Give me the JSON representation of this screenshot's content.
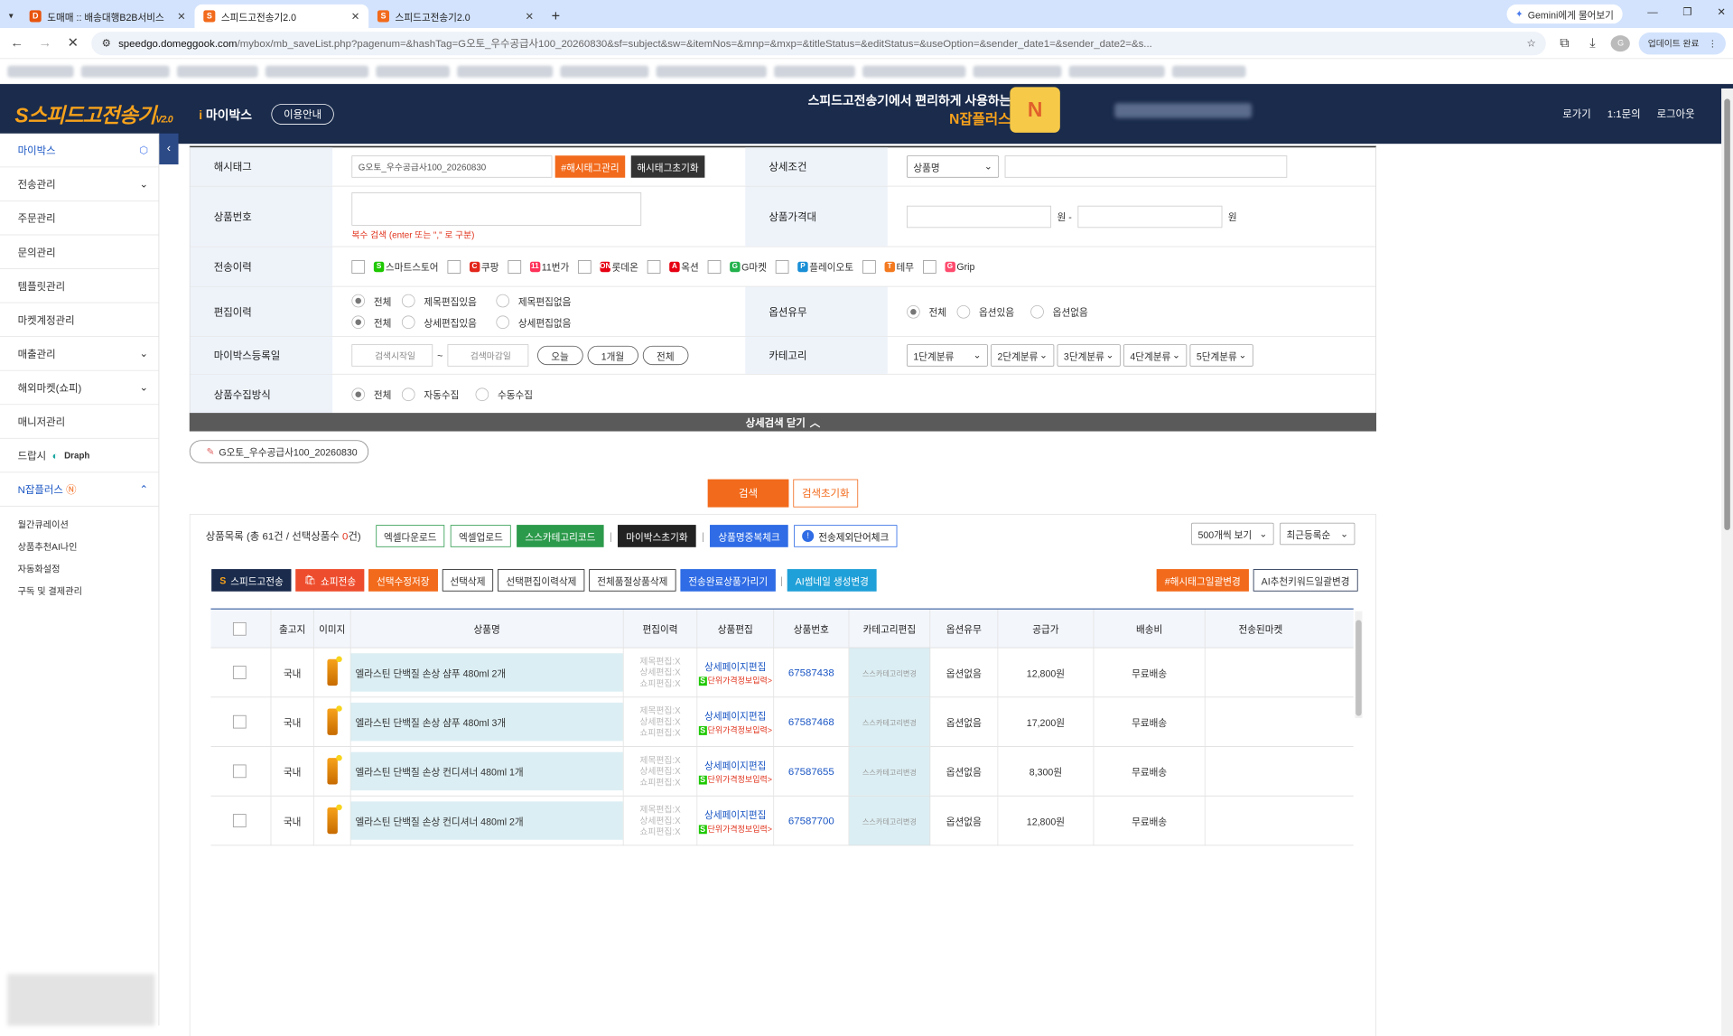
{
  "browser": {
    "tabs": [
      {
        "title": "도매매 :: 배송대행B2B서비스",
        "favicon": "d-icon",
        "color": "#e8540e"
      },
      {
        "title": "스피드고전송기2.0",
        "favicon": "s-icon",
        "color": "#f26a1b"
      },
      {
        "title": "스피드고전송기2.0",
        "favicon": "s-icon",
        "color": "#f26a1b"
      }
    ],
    "gemini_label": "Gemini에게 물어보기",
    "url_host": "speedgo.domeggook.com",
    "url_path": "/mybox/mb_saveList.php?pagenum=&hashTag=G오토_우수공급사100_20260830&sf=subject&sw=&itemNos=&mnp=&mxp=&titleStatus=&editStatus=&useOption=&sender_date1=&sender_date2=&s...",
    "update_label": "업데이트 완료"
  },
  "header": {
    "logo": "스피드고전송기",
    "logo_version": "V2.0",
    "mybox": "마이박스",
    "guide": "이용안내",
    "banner_line1": "스피드고전송기에서 편리하게 사용하는",
    "banner_line2": "N잡플러스",
    "links": [
      "로가기",
      "1:1문의",
      "로그아웃"
    ]
  },
  "sidebar": {
    "items": [
      {
        "label": "마이박스",
        "icon": "box-icon",
        "blue": true
      },
      {
        "label": "전송관리",
        "icon": "chevron-down-icon"
      },
      {
        "label": "주문관리"
      },
      {
        "label": "문의관리"
      },
      {
        "label": "템플릿관리"
      },
      {
        "label": "마켓계정관리"
      },
      {
        "label": "매출관리",
        "icon": "chevron-down-icon"
      },
      {
        "label": "해외마켓(쇼피)",
        "icon": "chevron-down-icon"
      },
      {
        "label": "매니저관리"
      },
      {
        "label": "드랍시",
        "extra": "Draph"
      },
      {
        "label": "N잡플러스",
        "icon": "chevron-up-icon",
        "blue": true
      }
    ],
    "subitems": [
      "월간큐레이션",
      "상품추천AI나인",
      "자동화설정",
      "구독 및 결제관리"
    ]
  },
  "form": {
    "hashtag_label": "해시태그",
    "hashtag_value": "G오토_우수공급사100_20260830",
    "hashtag_manage": "#해시태그관리",
    "hashtag_reset": "해시태그초기화",
    "detail_label": "상세조건",
    "detail_select": "상품명",
    "itemno_label": "상품번호",
    "itemno_hint": "복수 검색 (enter 또는 \",\" 로 구분)",
    "price_label": "상품가격대",
    "won": "원",
    "won_dash": "원 -",
    "history_label": "전송이력",
    "markets": [
      {
        "name": "스마트스토어",
        "icon": "S",
        "color": "#1ec800"
      },
      {
        "name": "쿠팡",
        "icon": "C",
        "color": "#e3261c"
      },
      {
        "name": "11번가",
        "icon": "11",
        "color": "#ff3259"
      },
      {
        "name": "롯데온",
        "icon": "ON",
        "color": "#e60012"
      },
      {
        "name": "옥션",
        "icon": "A",
        "color": "#e60012"
      },
      {
        "name": "G마켓",
        "icon": "G",
        "color": "#22b14c"
      },
      {
        "name": "플레이오토",
        "icon": "P",
        "color": "#1a8fd6"
      },
      {
        "name": "테무",
        "icon": "T",
        "color": "#f47a20"
      },
      {
        "name": "Grip",
        "icon": "G",
        "color": "#ff4b6e"
      }
    ],
    "edit_label": "편집이력",
    "edit_row1": [
      "전체",
      "제목편집있음",
      "제목편집없음"
    ],
    "edit_row2": [
      "전체",
      "상세편집있음",
      "상세편집없음"
    ],
    "option_label": "옵션유무",
    "option_choices": [
      "전체",
      "옵션있음",
      "옵션없음"
    ],
    "regdate_label": "마이박스등록일",
    "date_start": "검색시작일",
    "date_tilde": "~",
    "date_end": "검색마감일",
    "date_pills": [
      "오늘",
      "1개월",
      "전체"
    ],
    "category_label": "카테고리",
    "categories": [
      "1단계분류",
      "2단계분류",
      "3단계분류",
      "4단계분류",
      "5단계분류"
    ],
    "collect_label": "상품수집방식",
    "collect_choices": [
      "전체",
      "자동수집",
      "수동수집"
    ],
    "close_detail": "상세검색 닫기",
    "tag_chip": "G오토_우수공급사100_20260830",
    "search_btn": "검색",
    "reset_btn": "검색초기화"
  },
  "list": {
    "summary_prefix": "상품목록 (총 61건 / 선택상품수 ",
    "selected_count": "0",
    "summary_suffix": "건)",
    "top_buttons": [
      "엑셀다운로드",
      "엑셀업로드",
      "스스카테고리코드"
    ],
    "mybox_reset": "마이박스초기화",
    "dup_check": "상품명중복체크",
    "exclude_check": "전송제외단어체크",
    "view_select": "500개씩 보기",
    "sort_select": "최근등록순",
    "action_buttons": [
      "스피드고전송",
      "쇼피전송",
      "선택수정저장",
      "선택삭제",
      "선택편집이력삭제",
      "전체품절상품삭제",
      "전송완료상품가리기",
      "AI썸네일 생성변경"
    ],
    "right_buttons": [
      "#해시태그일괄변경",
      "AI추천키워드일괄변경"
    ],
    "columns": [
      "출고지",
      "이미지",
      "상품명",
      "편집이력",
      "상품편집",
      "상품번호",
      "카테고리편집",
      "옵션유무",
      "공급가",
      "배송비",
      "전송된마켓"
    ],
    "edit_history": [
      "제목편집:X",
      "상세편집:X",
      "쇼피편집:X"
    ],
    "detail_edit": "상세페이지편집",
    "unit_price": "단위가격정보입력>",
    "category_edit": "스스카테고리변경",
    "rows": [
      {
        "origin": "국내",
        "name": "엘라스틴 단백질 손상 샴푸 480ml 2개",
        "no": "67587438",
        "option": "옵션없음",
        "price": "12,800원",
        "ship": "무료배송"
      },
      {
        "origin": "국내",
        "name": "엘라스틴 단백질 손상 샴푸 480ml 3개",
        "no": "67587468",
        "option": "옵션없음",
        "price": "17,200원",
        "ship": "무료배송"
      },
      {
        "origin": "국내",
        "name": "엘라스틴 단백질 손상 컨디셔너 480ml 1개",
        "no": "67587655",
        "option": "옵션없음",
        "price": "8,300원",
        "ship": "무료배송"
      },
      {
        "origin": "국내",
        "name": "엘라스틴 단백질 손상 컨디셔너 480ml 2개",
        "no": "67587700",
        "option": "옵션없음",
        "price": "12,800원",
        "ship": "무료배송"
      }
    ]
  }
}
